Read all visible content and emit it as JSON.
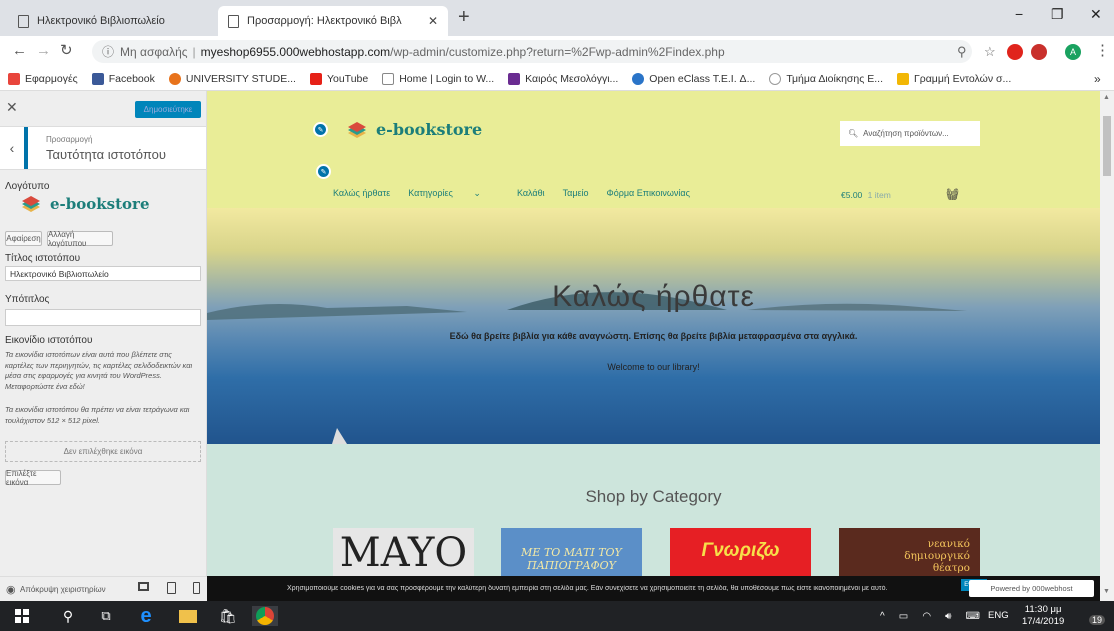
{
  "browser": {
    "tabs": [
      {
        "title": "Ηλεκτρονικό Βιβλιοπωλείο",
        "active": false
      },
      {
        "title": "Προσαρμογή: Ηλεκτρονικό Βιβλ",
        "active": true
      }
    ],
    "new_tab": "+",
    "window_controls": [
      "−",
      "❐",
      "✕"
    ],
    "address": {
      "security": "Μη ασφαλής",
      "separator": "|",
      "host": "myeshop6955.000webhostapp.com",
      "path": "/wp-admin/customize.php?return=%2Fwp-admin%2Findex.php"
    },
    "bookmarks": [
      {
        "label": "Εφαρμογές",
        "color": "#e8453c"
      },
      {
        "label": "Facebook",
        "color": "#3b5998"
      },
      {
        "label": "UNIVERSITY STUDE...",
        "color": "#e8731c"
      },
      {
        "label": "YouTube",
        "color": "#e62117"
      },
      {
        "label": "Home | Login to W...",
        "color": "#888888"
      },
      {
        "label": "Καιρός Μεσολόγγι...",
        "color": "#6a2c91"
      },
      {
        "label": "Open eClass T.E.I. Δ...",
        "color": "#2a74c8"
      },
      {
        "label": "Τμήμα Διοίκησης Ε...",
        "color": "#999999"
      },
      {
        "label": "Γραμμή Εντολών σ...",
        "color": "#f2b705"
      }
    ],
    "bookmarks_more": "»"
  },
  "sidebar": {
    "close": "✕",
    "publish_label": "Δημοσιεύτηκε",
    "back": "‹",
    "section_parent": "Προσαρμογή",
    "section_title": "Ταυτότητα ιστοτόπου",
    "logo_heading": "Λογότυπο",
    "logo_text": "e-bookstore",
    "remove_label": "Αφαίρεση",
    "change_logo_label": "Αλλαγή λογότυπου",
    "site_title_heading": "Τίτλος ιστοτόπου",
    "site_title_value": "Ηλεκτρονικό Βιβλιοπωλείο",
    "tagline_heading": "Υπότιτλος",
    "tagline_value": "",
    "site_icon_heading": "Εικονίδιο ιστοτόπου",
    "site_icon_desc1": "Τα εικονίδια ιστοτόπων είναι αυτά που βλέπετε στις καρτέλες των περιηγητών, τις καρτέλες σελιδοδεικτών και μέσα στις εφαρμογές για κινητά του WordPress. Μεταφορτώστε ένα εδώ!",
    "site_icon_desc2": "Τα εικονίδια ιστοτόπου θα πρέπει να είναι τετράγωνα και τουλάχιστον 512 × 512 pixel.",
    "no_image": "Δεν επιλέχθηκε εικόνα",
    "select_image": "Επιλέξτε εικόνα",
    "hide_controls": "Απόκρυψη χειριστηρίων"
  },
  "preview": {
    "brand": "e-bookstore",
    "search_placeholder": "Αναζήτηση προϊόντων...",
    "menu": [
      "Καλώς ήρθατε",
      "Κατηγορίες",
      "Καλάθι",
      "Ταμείο",
      "Φόρμα Επικοινωνίας"
    ],
    "cart_amount": "€5.00",
    "cart_items": "1 item",
    "hero_title": "Καλώς ήρθατε",
    "hero_subtitle": "Εδώ θα βρείτε βιβλία για κάθε αναγνώστη. Επίσης θα βρείτε βιβλία μεταφρασμένα στα αγγλικά.",
    "hero_welcome": "Welcome to our library!",
    "shop_heading": "Shop by Category",
    "books": [
      {
        "text": "MAYO",
        "bg": "#e6e6e6",
        "fg": "#222222"
      },
      {
        "text": "ΜΕ ΤΟ ΜΑΤΙ ΤΟΥ ΠΑΠΙΟΓΡΑΦΟΥ",
        "bg": "#5b8fc8",
        "fg": "#f3e9a6"
      },
      {
        "text": "Γνωριζω",
        "bg": "#e61f24",
        "fg": "#f7e04a"
      },
      {
        "text": "νεανικό δημιουργικό θέατρο",
        "bg": "#5a2a1e",
        "fg": "#f2c35b"
      }
    ]
  },
  "cookie": {
    "text": "Χρησιμοποιούμε cookies για να σας προσφέρουμε την καλύτερη δυνατή εμπειρία στη σελίδα μας. Εάν συνεχίσετε να χρησιμοποιείτε τη σελίδα, θα υποθέσουμε πως είστε ικανοποιημένοι με αυτό.",
    "ok": "Εντάξει",
    "powered": "Powered by 000webhost"
  },
  "taskbar": {
    "lang": "ENG",
    "time": "11:30 μμ",
    "date": "17/4/2019",
    "notifications": "19"
  },
  "colors": {
    "header_bg": "#e9ed97",
    "brand_teal": "#1c7e7a",
    "wp_blue": "#0073aa",
    "category_bg": "#cde5dc"
  }
}
